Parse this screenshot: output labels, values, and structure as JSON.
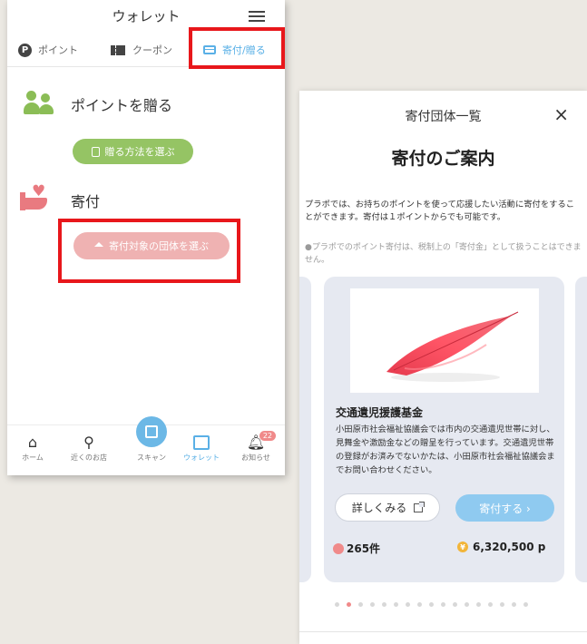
{
  "wallet": {
    "title": "ウォレット",
    "tabs": [
      {
        "label": "ポイント",
        "icon": "p"
      },
      {
        "label": "クーポン"
      },
      {
        "label": "寄付/贈る"
      }
    ],
    "gift_section": {
      "title": "ポイントを贈る",
      "button": "贈る方法を選ぶ"
    },
    "donate_section": {
      "title": "寄付",
      "button": "寄付対象の団体を選ぶ"
    },
    "nav": {
      "home": "ホーム",
      "nearby": "近くのお店",
      "scan": "スキャン",
      "wallet": "ウォレット",
      "notice": "お知らせ",
      "notice_badge": "22"
    },
    "active_color": "#5ab0e6",
    "highlight_color": "#e8171b"
  },
  "donation_list": {
    "header": "寄付団体一覧",
    "close": "×",
    "title": "寄付のご案内",
    "description": "プラポでは、お持ちのポイントを使って応援したい活動に寄付をすることができます。寄付は１ポイントからでも可能です。",
    "note": "●プラポでのポイント寄付は、税制上の「寄付金」として扱うことはできません。",
    "card": {
      "name": "交通遺児援護基金",
      "description": "小田原市社会福祉協議会では市内の交通遺児世帯に対し、見舞金や激励金などの贈呈を行っています。交通遺児世帯の登録がお済みでないかたは、小田原市社会福祉協議会までお問い合わせください。",
      "detail_button": "詳しくみる",
      "donate_button": "寄付する ›",
      "count": "265件",
      "amount": "6,320,500 p",
      "yen_symbol": "¥"
    },
    "pager": {
      "total": 17,
      "active_index": 1
    }
  }
}
